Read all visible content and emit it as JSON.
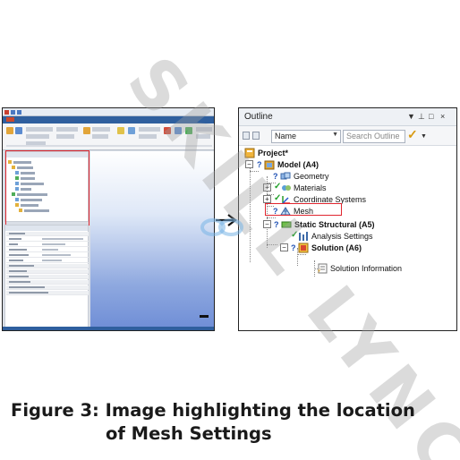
{
  "outline": {
    "title": "Outline",
    "window_controls": [
      "▼",
      "⊥",
      "□",
      "×"
    ],
    "filter_field": "Name",
    "search_placeholder": "Search Outline",
    "tree": {
      "project": "Project*",
      "model": "Model (A4)",
      "geometry": "Geometry",
      "materials": "Materials",
      "coordinate_systems": "Coordinate Systems",
      "mesh": "Mesh",
      "static_structural": "Static Structural (A5)",
      "analysis_settings": "Analysis Settings",
      "solution": "Solution (A6)",
      "solution_information": "Solution Information"
    }
  },
  "caption": {
    "line1": "Figure 3: Image highlighting the location",
    "line2": "of Mesh Settings"
  },
  "watermark": {
    "text": "SKILL LYNC"
  },
  "colors": {
    "highlight": "#e0262f",
    "ribbon_blue": "#2f5f9e",
    "tree_check": "#22a02a",
    "tree_question": "#1d4fb3"
  }
}
